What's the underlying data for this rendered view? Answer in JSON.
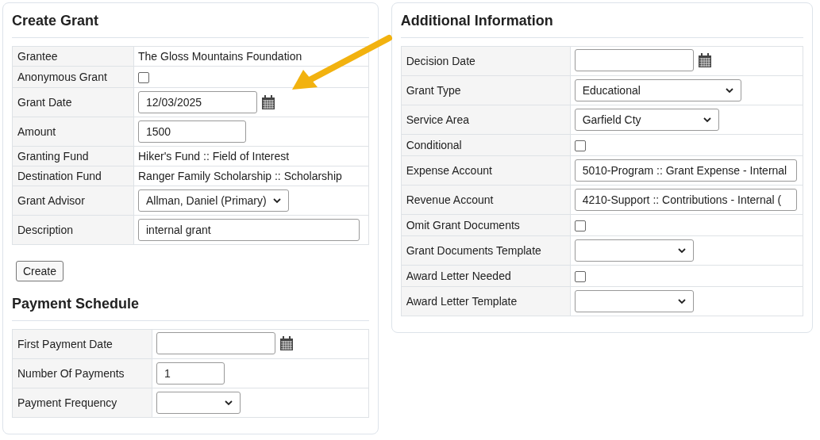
{
  "create_grant": {
    "title": "Create Grant",
    "rows": [
      {
        "label": "Grantee",
        "kind": "text",
        "value": "The Gloss Mountains Foundation"
      },
      {
        "label": "Anonymous Grant",
        "kind": "checkbox",
        "checked": false
      },
      {
        "label": "Grant Date",
        "kind": "date",
        "value": "12/03/2025"
      },
      {
        "label": "Amount",
        "kind": "input",
        "value": "1500"
      },
      {
        "label": "Granting Fund",
        "kind": "text",
        "value": "Hiker's Fund :: Field of Interest"
      },
      {
        "label": "Destination Fund",
        "kind": "text",
        "value": "Ranger Family Scholarship :: Scholarship"
      },
      {
        "label": "Grant Advisor",
        "kind": "select",
        "value": "Allman, Daniel (Primary)"
      },
      {
        "label": "Description",
        "kind": "input",
        "value": "internal grant"
      }
    ],
    "button": "Create"
  },
  "payment_schedule": {
    "title": "Payment Schedule",
    "rows": [
      {
        "label": "First Payment Date",
        "kind": "date"
      },
      {
        "label": "Number Of Payments",
        "kind": "input",
        "value": "1"
      },
      {
        "label": "Payment Frequency",
        "kind": "select"
      }
    ]
  },
  "additional_information": {
    "title": "Additional Information",
    "rows": [
      {
        "label": "Decision Date",
        "kind": "date"
      },
      {
        "label": "Grant Type",
        "kind": "select",
        "value": "Educational"
      },
      {
        "label": "Service Area",
        "kind": "select",
        "value": "Garfield Cty"
      },
      {
        "label": "Conditional",
        "kind": "checkbox",
        "checked": false
      },
      {
        "label": "Expense Account",
        "kind": "input",
        "value": "5010-Program :: Grant Expense - Internal"
      },
      {
        "label": "Revenue Account",
        "kind": "input",
        "value": "4210-Support :: Contributions - Internal ("
      },
      {
        "label": "Omit Grant Documents",
        "kind": "checkbox",
        "checked": false
      },
      {
        "label": "Grant Documents Template",
        "kind": "select"
      },
      {
        "label": "Award Letter Needed",
        "kind": "checkbox",
        "checked": false
      },
      {
        "label": "Award Letter Template",
        "kind": "select"
      }
    ]
  }
}
